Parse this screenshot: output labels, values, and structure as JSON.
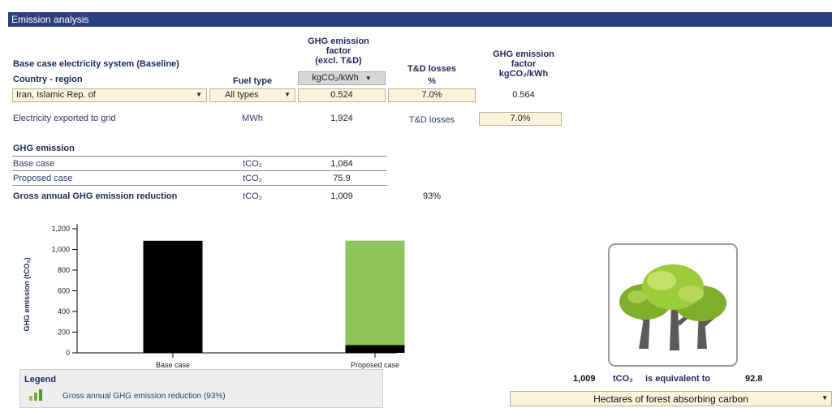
{
  "header": {
    "title": "Emission analysis"
  },
  "baseline": {
    "section_title": "Base case electricity system (Baseline)",
    "country_header": "Country - region",
    "fuel_header": "Fuel type",
    "ghg_factor_header_1": "GHG emission",
    "ghg_factor_header_2": "factor",
    "ghg_factor_header_3": "(excl. T&D)",
    "td_header": "T&D losses",
    "td_unit": "%",
    "ghg_factor2_header_1": "GHG emission",
    "ghg_factor2_header_2": "factor",
    "ghg_factor2_unit": "kgCO₂/kWh",
    "unit_dropdown": "kgCO₂/kWh",
    "country_value": "Iran, Islamic Rep. of",
    "fuel_value": "All types",
    "ghg_factor_value": "0.524",
    "td_value": "7.0%",
    "ghg_factor2_value": "0.564"
  },
  "export_row": {
    "label": "Electricity exported to grid",
    "unit": "MWh",
    "value": "1,924",
    "td_label": "T&D losses",
    "td_value": "7.0%"
  },
  "ghg": {
    "section_title": "GHG emission",
    "rows": [
      {
        "label": "Base case",
        "unit": "tCO₂",
        "value": "1,084",
        "pct": ""
      },
      {
        "label": "Proposed case",
        "unit": "tCO₂",
        "value": "75.9",
        "pct": ""
      },
      {
        "label": "Gross annual GHG emission reduction",
        "unit": "tCO₂",
        "value": "1,009",
        "pct": "93%"
      }
    ]
  },
  "chart_data": {
    "type": "bar",
    "categories": [
      "Base case",
      "Proposed case"
    ],
    "ylabel": "GHG emission (tCO₂)",
    "ylim": [
      0,
      1200
    ],
    "yticks": [
      "0",
      "200",
      "400",
      "600",
      "800",
      "1,000",
      "1,200"
    ],
    "series": [
      {
        "name": "",
        "values": [
          1084,
          75.9
        ],
        "color": "#000000"
      },
      {
        "name": "Gross annual GHG emission reduction (93%)",
        "values": [
          0,
          1009
        ],
        "color": "#8fc45a"
      }
    ],
    "grid": false,
    "legend_position": "bottom"
  },
  "legend": {
    "title": "Legend",
    "item": "Gross annual GHG emission reduction (93%)"
  },
  "equivalence": {
    "value": "1,009",
    "unit": "tCO₂",
    "text": "is equivalent to",
    "result": "92.8",
    "dropdown": "Hectares of forest absorbing carbon"
  },
  "colors": {
    "title_bg": "#2b3f7d",
    "input_bg": "#fbf3dc",
    "reduction_green": "#8fc45a",
    "base_black": "#000000"
  }
}
